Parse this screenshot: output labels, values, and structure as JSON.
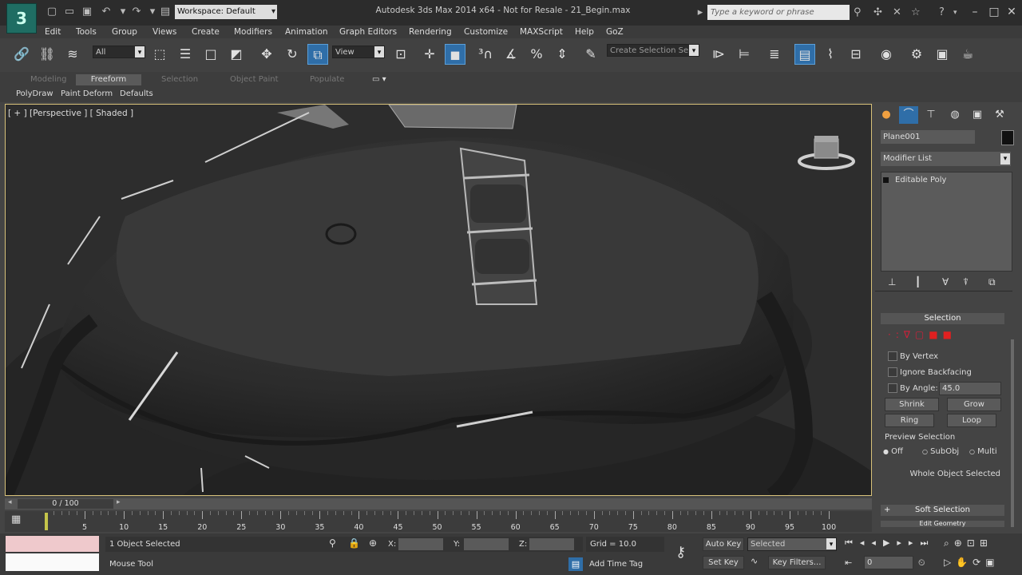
{
  "title_bar": {
    "app_title": "Autodesk 3ds Max  2014 x64   - Not for Resale -   21_Begin.max",
    "workspace_label": "Workspace: Default",
    "search_placeholder": "Type a keyword or phrase"
  },
  "menu": [
    "Edit",
    "Tools",
    "Group",
    "Views",
    "Create",
    "Modifiers",
    "Animation",
    "Graph Editors",
    "Rendering",
    "Customize",
    "MAXScript",
    "Help",
    "GoZ"
  ],
  "main_toolbar": {
    "selection_filter": "All",
    "ref_coord_system": "View",
    "named_selection_placeholder": "Create Selection Se"
  },
  "ribbon": {
    "tabs": [
      "Modeling",
      "Freeform",
      "Selection",
      "Object Paint",
      "Populate"
    ],
    "active_tab": "Freeform",
    "subtabs": [
      "PolyDraw",
      "Paint Deform",
      "Defaults"
    ]
  },
  "viewport": {
    "label": "[ + ] [Perspective ] [ Shaded ]"
  },
  "command_panel": {
    "object_name": "Plane001",
    "modifier_list": "Modifier List",
    "stack_item": "Editable Poly",
    "selection_rollout": {
      "title": "Selection",
      "by_vertex": "By Vertex",
      "ignore_backfacing": "Ignore Backfacing",
      "by_angle": "By Angle:",
      "angle_value": "45.0",
      "shrink": "Shrink",
      "grow": "Grow",
      "ring": "Ring",
      "loop": "Loop",
      "preview_title": "Preview Selection",
      "preview_options": [
        "Off",
        "SubObj",
        "Multi"
      ],
      "status": "Whole Object Selected"
    },
    "soft_selection": "Soft Selection",
    "edit_geometry": "Edit Geometry"
  },
  "timeline": {
    "frame_display": "0 / 100",
    "ticks": [
      "5",
      "10",
      "15",
      "20",
      "25",
      "30",
      "35",
      "40",
      "45",
      "50",
      "55",
      "60",
      "65",
      "70",
      "75",
      "80",
      "85",
      "90",
      "95",
      "100"
    ]
  },
  "status_bar": {
    "selection_status": "1 Object Selected",
    "prompt": "Mouse Tool",
    "x_label": "X:",
    "y_label": "Y:",
    "z_label": "Z:",
    "grid": "Grid = 10.0",
    "auto_key": "Auto Key",
    "set_key": "Set Key",
    "key_mode": "Selected",
    "key_filters": "Key Filters...",
    "add_time_tag": "Add Time Tag",
    "current_frame": "0"
  },
  "colors": {
    "viewport_border": "#d8c27a",
    "active_blue": "#2f6ea8",
    "maxscript_listener": "#efc9cc",
    "logo_teal": "#1f6d63"
  }
}
